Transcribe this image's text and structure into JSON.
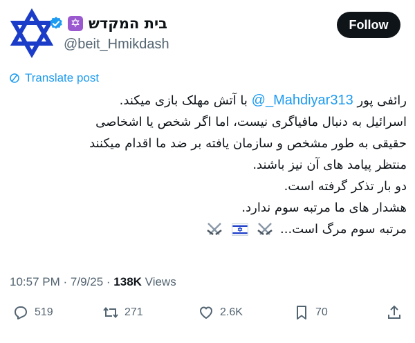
{
  "author": {
    "display_name": "בית המקדש",
    "name_emoji": "✡",
    "handle": "@beit_Hmikdash",
    "verified": true
  },
  "follow_button": {
    "label": "Follow"
  },
  "translate_link": "Translate post",
  "post": {
    "line1": {
      "mention": "@_Mahdiyar313",
      "after": "رائفی پور",
      "before": "با آتش مهلک بازی میکند."
    },
    "lines": [
      "اسرائیل به دنبال مافیاگری نیست، اما اگر شخص یا اشخاصی",
      "حقیقی به طور مشخص و سازمان یافته بر ضد ما اقدام میکنند",
      "منتظر پیامد های آن نیز باشند.",
      "دو بار تذکر گرفته است.",
      "هشدار های ما مرتبه سوم ندارد."
    ],
    "last_line": "مرتبه سوم مرگ است...",
    "emojis": [
      "crossed-swords",
      "israel-flag",
      "crossed-swords"
    ]
  },
  "meta": {
    "time": "10:57 PM",
    "date": "7/9/25",
    "views_count": "138K",
    "views_label": "Views"
  },
  "actions": {
    "replies": "519",
    "reposts": "271",
    "likes": "2.6K",
    "bookmarks": "70"
  },
  "colors": {
    "accent": "#1d9bf0",
    "star": "#1a3cc8",
    "follow_bg": "#0f1419"
  }
}
